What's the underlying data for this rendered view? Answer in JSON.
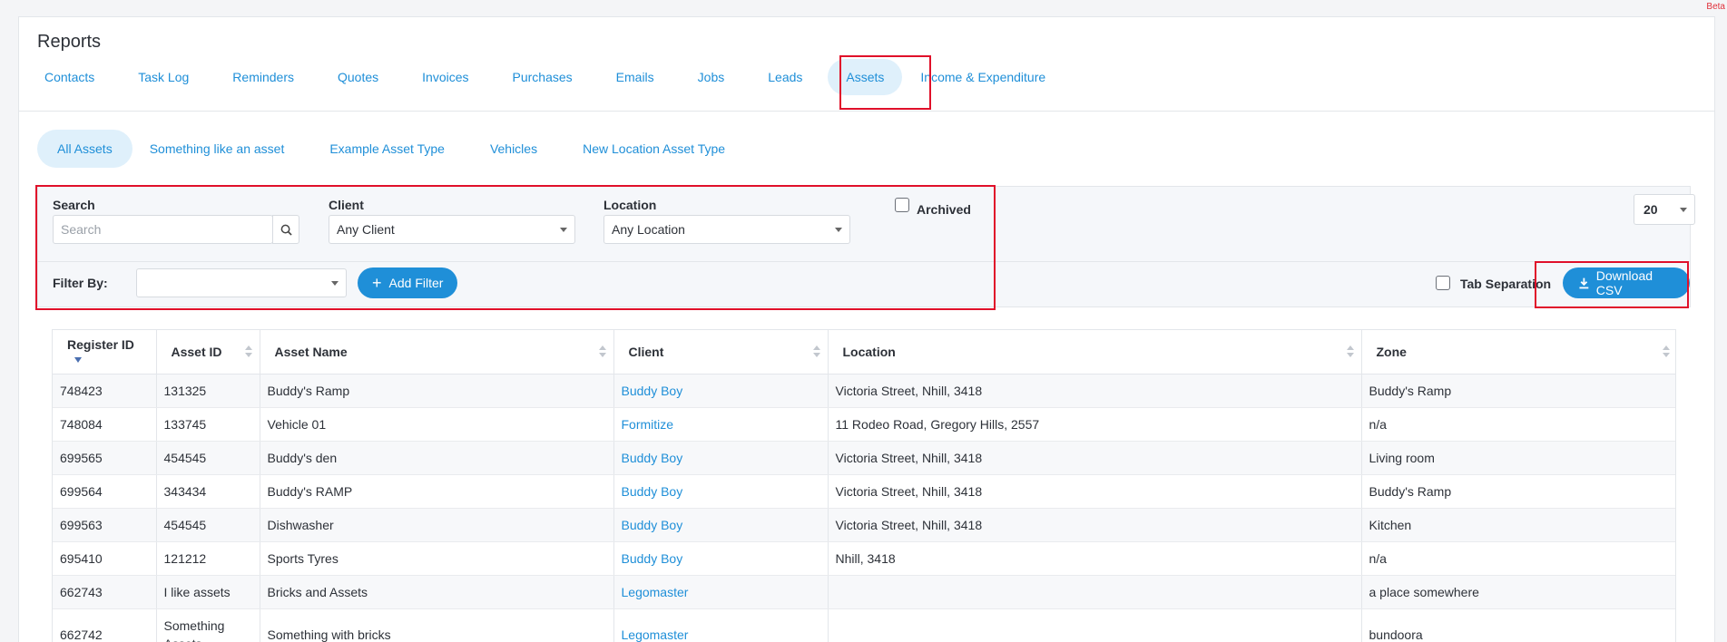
{
  "beta_label": "Beta",
  "page_title": "Reports",
  "tabs": [
    {
      "label": "Contacts"
    },
    {
      "label": "Task Log"
    },
    {
      "label": "Reminders"
    },
    {
      "label": "Quotes"
    },
    {
      "label": "Invoices"
    },
    {
      "label": "Purchases"
    },
    {
      "label": "Emails"
    },
    {
      "label": "Jobs"
    },
    {
      "label": "Leads"
    },
    {
      "label": "Assets",
      "active": true
    },
    {
      "label": "Income & Expenditure"
    }
  ],
  "subtabs": [
    {
      "label": "All Assets",
      "active": true
    },
    {
      "label": "Something like an asset"
    },
    {
      "label": "Example Asset Type"
    },
    {
      "label": "Vehicles"
    },
    {
      "label": "New Location Asset Type"
    }
  ],
  "filters": {
    "search_label": "Search",
    "search_placeholder": "Search",
    "client_label": "Client",
    "client_value": "Any Client",
    "location_label": "Location",
    "location_value": "Any Location",
    "archived_label": "Archived",
    "filter_by_label": "Filter By:",
    "filter_by_value": "",
    "add_filter_label": "Add Filter",
    "page_size": "20",
    "tab_separation_label": "Tab Separation",
    "download_csv_label": "Download CSV"
  },
  "table": {
    "columns": [
      "Register ID",
      "Asset ID",
      "Asset Name",
      "Client",
      "Location",
      "Zone"
    ],
    "rows": [
      [
        "748423",
        "131325",
        "Buddy's Ramp",
        "Buddy Boy",
        "Victoria Street, Nhill, 3418",
        "Buddy's Ramp"
      ],
      [
        "748084",
        "133745",
        "Vehicle 01",
        "Formitize",
        "11 Rodeo Road, Gregory Hills, 2557",
        "n/a"
      ],
      [
        "699565",
        "454545",
        "Buddy's den",
        "Buddy Boy",
        "Victoria Street, Nhill, 3418",
        "Living room"
      ],
      [
        "699564",
        "343434",
        "Buddy's RAMP",
        "Buddy Boy",
        "Victoria Street, Nhill, 3418",
        "Buddy's Ramp"
      ],
      [
        "699563",
        "454545",
        "Dishwasher",
        "Buddy Boy",
        "Victoria Street, Nhill, 3418",
        "Kitchen"
      ],
      [
        "695410",
        "121212",
        "Sports Tyres",
        "Buddy Boy",
        "Nhill, 3418",
        "n/a"
      ],
      [
        "662743",
        "I like assets",
        "Bricks and Assets",
        "Legomaster",
        "",
        "a place somewhere"
      ],
      [
        "662742",
        "Something Assets",
        "Something with bricks",
        "Legomaster",
        "",
        "bundoora"
      ]
    ]
  },
  "colors": {
    "accent": "#1f8fd8",
    "highlight": "#e0102a",
    "active_tab_bg": "#dff0fb"
  }
}
